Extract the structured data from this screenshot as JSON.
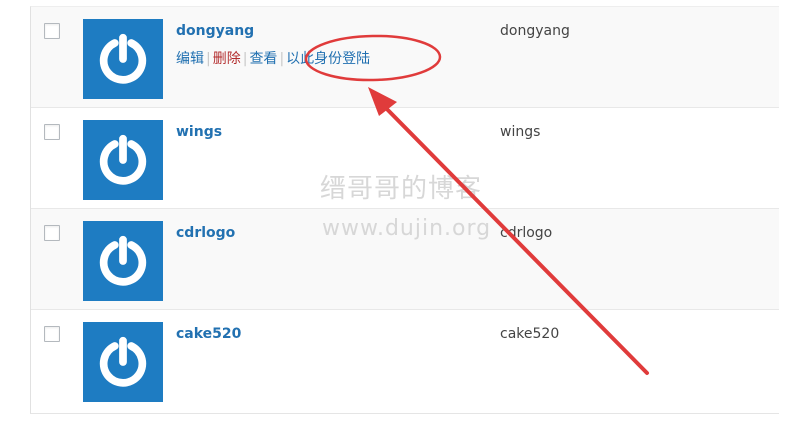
{
  "users": [
    {
      "username": "dongyang",
      "name": "dongyang",
      "actions": {
        "edit": "编辑",
        "delete": "删除",
        "view": "查看",
        "login_as": "以此身份登陆"
      }
    },
    {
      "username": "wings",
      "name": "wings"
    },
    {
      "username": "cdrlogo",
      "name": "cdrlogo"
    },
    {
      "username": "cake520",
      "name": "cake520"
    }
  ],
  "watermark": {
    "line1": "缙哥哥的博客",
    "line2": "www.dujin.org"
  },
  "colors": {
    "link": "#2271b1",
    "delete": "#b32d2e",
    "avatar": "#1e7cc2",
    "annotation": "#e03b3b"
  },
  "icons": {
    "avatar": "power-icon"
  }
}
